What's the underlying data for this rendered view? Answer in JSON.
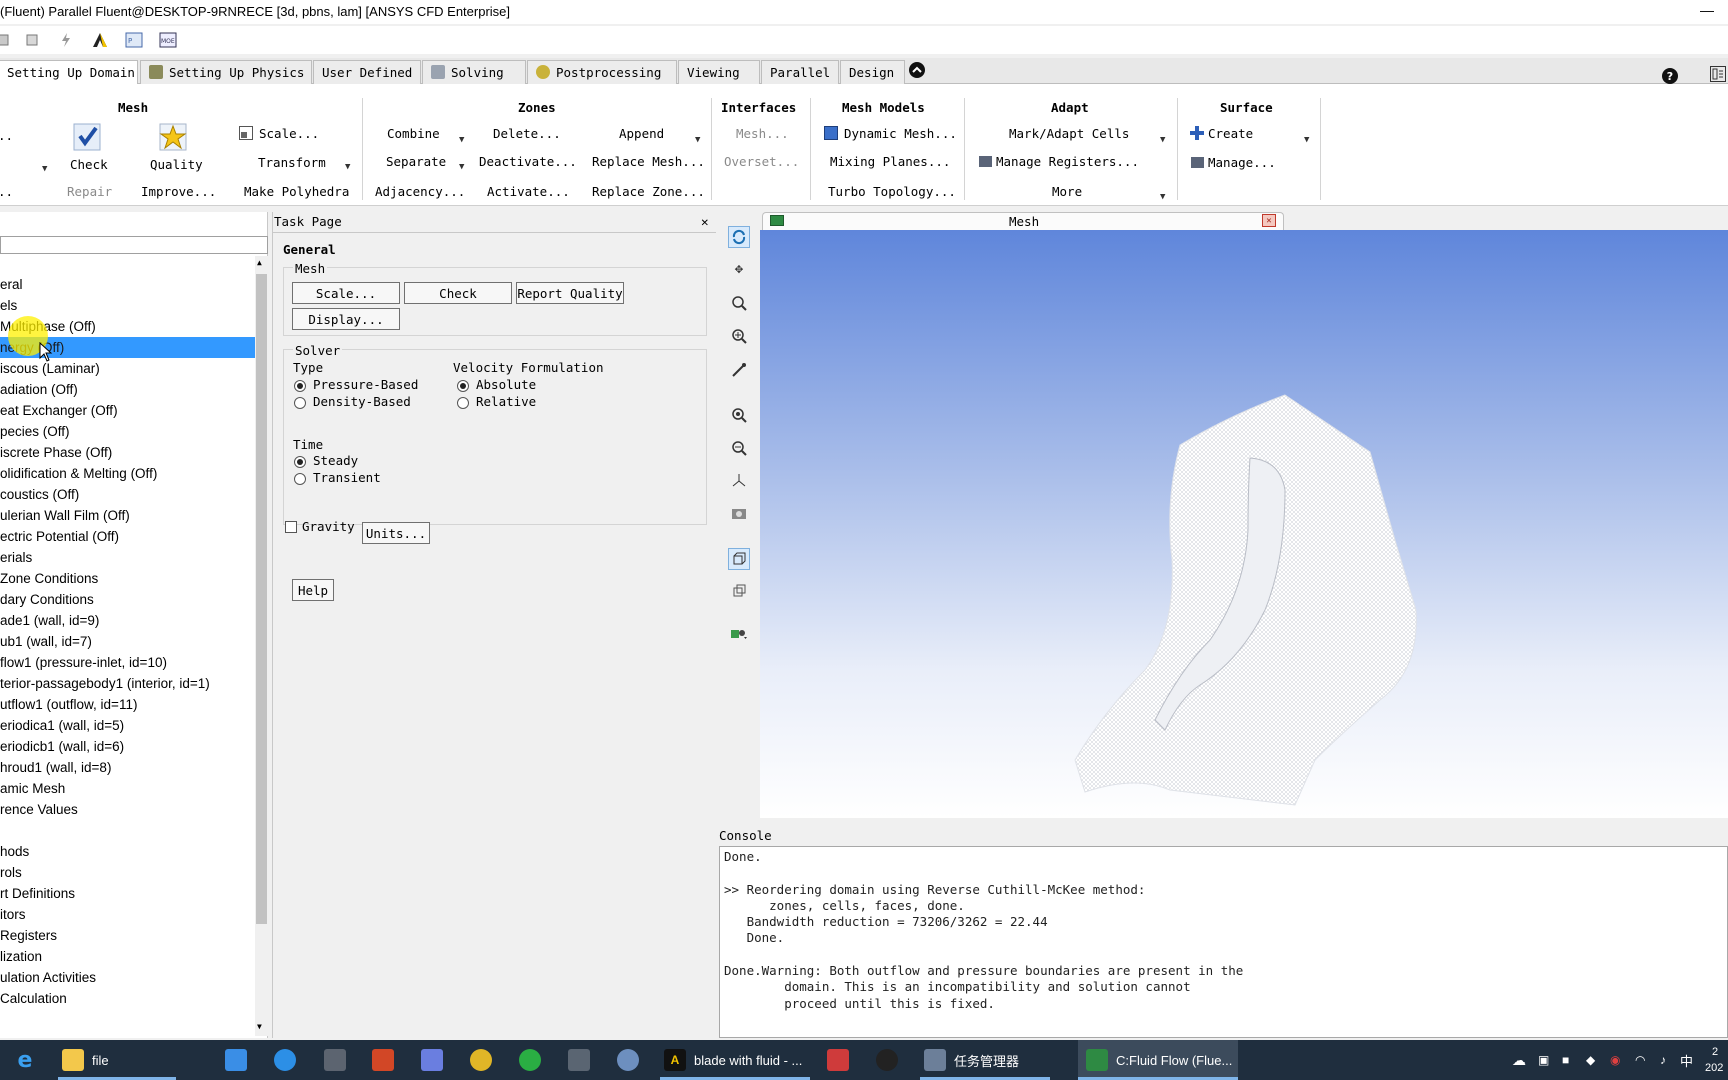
{
  "window": {
    "title": "(Fluent) Parallel Fluent@DESKTOP-9RNRECE  [3d, pbns, lam] [ANSYS CFD Enterprise]",
    "minimize": "—"
  },
  "ribbon_tabs": [
    {
      "label": "Setting Up Domain",
      "active": true
    },
    {
      "label": "Setting Up Physics"
    },
    {
      "label": "User Defined"
    },
    {
      "label": "Solving"
    },
    {
      "label": "Postprocessing"
    },
    {
      "label": "Viewing"
    },
    {
      "label": "Parallel"
    },
    {
      "label": "Design"
    }
  ],
  "ribbon": {
    "mesh": {
      "title": "Mesh",
      "check": "Check",
      "quality": "Quality",
      "scale": "Scale...",
      "transform": "Transform",
      "repair": "Repair",
      "improve": "Improve...",
      "make_polyhedra": "Make Polyhedra",
      "left_dot1": "..",
      "left_dot2": ".."
    },
    "zones": {
      "title": "Zones",
      "combine": "Combine",
      "separate": "Separate",
      "adjacency": "Adjacency...",
      "delete": "Delete...",
      "deactivate": "Deactivate...",
      "activate": "Activate...",
      "append": "Append",
      "replace_mesh": "Replace Mesh...",
      "replace_zone": "Replace Zone..."
    },
    "interfaces": {
      "title": "Interfaces",
      "mesh": "Mesh...",
      "overset": "Overset..."
    },
    "mesh_models": {
      "title": "Mesh Models",
      "dynamic_mesh": "Dynamic Mesh...",
      "mixing_planes": "Mixing Planes...",
      "turbo_topology": "Turbo Topology..."
    },
    "adapt": {
      "title": "Adapt",
      "mark_adapt": "Mark/Adapt Cells",
      "manage_registers": "Manage Registers...",
      "more": "More"
    },
    "surface": {
      "title": "Surface",
      "create": "Create",
      "manage": "Manage..."
    }
  },
  "tree": {
    "items": [
      {
        "label": "eral"
      },
      {
        "label": "els"
      },
      {
        "label": "Multiphase (Off)"
      },
      {
        "label": "nergy (Off)",
        "selected": true
      },
      {
        "label": "iscous (Laminar)"
      },
      {
        "label": "adiation (Off)"
      },
      {
        "label": "eat Exchanger (Off)"
      },
      {
        "label": "pecies (Off)"
      },
      {
        "label": "iscrete Phase (Off)"
      },
      {
        "label": "olidification & Melting (Off)"
      },
      {
        "label": "coustics (Off)"
      },
      {
        "label": "ulerian Wall Film (Off)"
      },
      {
        "label": "ectric Potential (Off)"
      },
      {
        "label": "erials"
      },
      {
        "label": "Zone Conditions"
      },
      {
        "label": "dary Conditions"
      },
      {
        "label": "ade1 (wall, id=9)"
      },
      {
        "label": "ub1 (wall, id=7)"
      },
      {
        "label": "flow1 (pressure-inlet, id=10)"
      },
      {
        "label": "terior-passagebody1 (interior, id=1)"
      },
      {
        "label": "utflow1 (outflow, id=11)"
      },
      {
        "label": "eriodica1 (wall, id=5)"
      },
      {
        "label": "eriodicb1 (wall, id=6)"
      },
      {
        "label": "hroud1 (wall, id=8)"
      },
      {
        "label": "amic Mesh"
      },
      {
        "label": "rence Values"
      },
      {
        "label": ""
      },
      {
        "label": "hods"
      },
      {
        "label": "rols"
      },
      {
        "label": "rt Definitions"
      },
      {
        "label": "itors"
      },
      {
        "label": "Registers"
      },
      {
        "label": "lization"
      },
      {
        "label": "ulation Activities"
      },
      {
        "label": "Calculation"
      }
    ]
  },
  "task_page": {
    "header": "Task Page",
    "close": "✕",
    "title": "General",
    "mesh_group": "Mesh",
    "scale_btn": "Scale...",
    "check_btn": "Check",
    "report_quality_btn": "Report Quality",
    "display_btn": "Display...",
    "solver_group": "Solver",
    "type_label": "Type",
    "pressure_based": "Pressure-Based",
    "density_based": "Density-Based",
    "velocity_label": "Velocity Formulation",
    "absolute": "Absolute",
    "relative": "Relative",
    "time_label": "Time",
    "steady": "Steady",
    "transient": "Transient",
    "gravity": "Gravity",
    "units_btn": "Units...",
    "help_btn": "Help"
  },
  "graphics": {
    "title": "Mesh",
    "close": "✕"
  },
  "console": {
    "label": "Console",
    "text": "Done.\n\n>> Reordering domain using Reverse Cuthill-McKee method:\n      zones, cells, faces, done.\n   Bandwidth reduction = 73206/3262 = 22.44\n   Done.\n\nDone.Warning: Both outflow and pressure boundaries are present in the\n        domain. This is an incompatibility and solution cannot\n        proceed until this is fixed."
  },
  "taskbar": {
    "file": "file",
    "blade": "blade with fluid - ...",
    "task_manager": "任务管理器",
    "fluent": "C:Fluid Flow (Flue...",
    "ime": "中",
    "clock": "2",
    "date": "202"
  }
}
